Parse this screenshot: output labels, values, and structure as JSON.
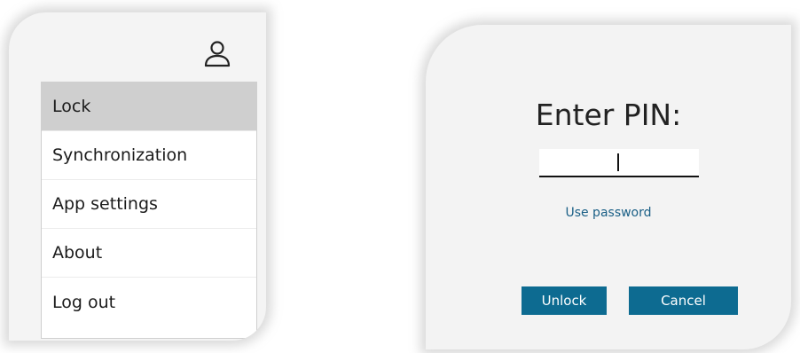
{
  "account_menu": {
    "icon": "user-icon",
    "items": [
      {
        "label": "Lock",
        "selected": true
      },
      {
        "label": "Synchronization",
        "selected": false
      },
      {
        "label": "App settings",
        "selected": false
      },
      {
        "label": "About",
        "selected": false
      },
      {
        "label": "Log out",
        "selected": false
      }
    ]
  },
  "pin_dialog": {
    "title": "Enter PIN:",
    "pin_value": "",
    "use_password_label": "Use password",
    "unlock_label": "Unlock",
    "cancel_label": "Cancel"
  },
  "colors": {
    "accent": "#0d6b91",
    "link": "#1a5f86",
    "selected_item": "#cfcfcf",
    "card_background": "#f4f4f4"
  }
}
